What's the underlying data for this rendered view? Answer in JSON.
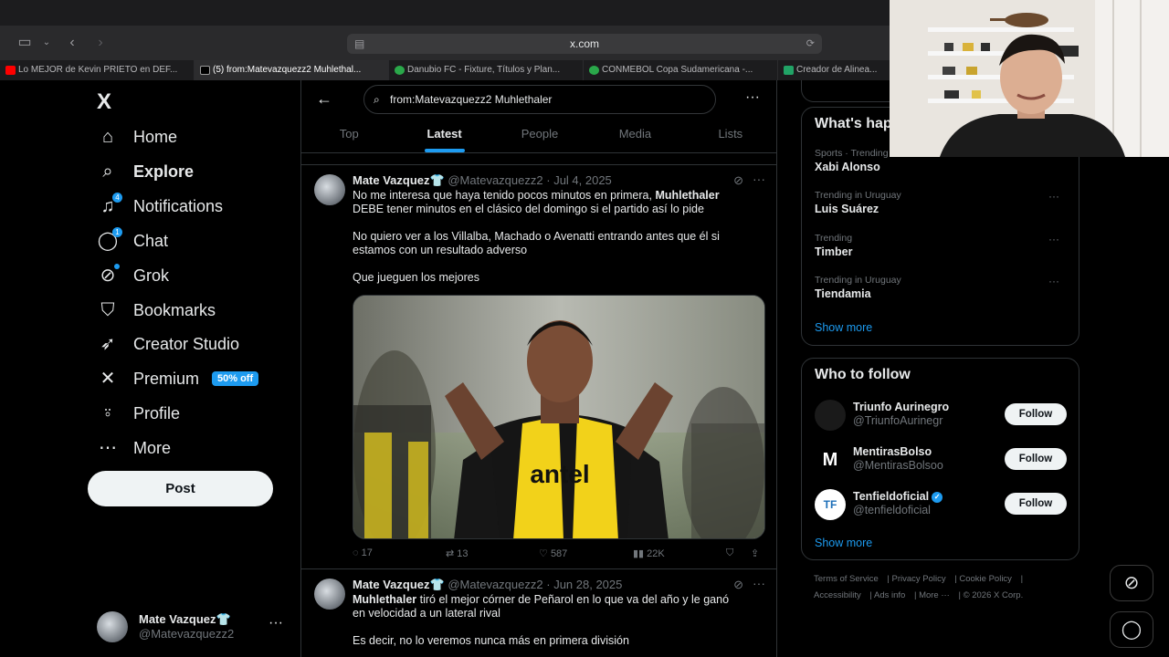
{
  "browser": {
    "url": "x.com",
    "tabs": [
      {
        "label": "Lo MEJOR de Kevin PRIETO en DEF...",
        "favicon_color": "#ff0000"
      },
      {
        "label": "(5) from:Matevazquezz2 Muhlethal...",
        "favicon_color": "#000000",
        "active": true
      },
      {
        "label": "Danubio FC - Fixture, Títulos y Plan...",
        "favicon_color": "#2aa84a"
      },
      {
        "label": "CONMEBOL Copa Sudamericana -...",
        "favicon_color": "#2aa84a"
      },
      {
        "label": "Creador de Alinea...",
        "favicon_color": "#21a366"
      }
    ]
  },
  "sidebar": {
    "logo": "X",
    "items": [
      {
        "label": "Home",
        "icon": "home-icon",
        "glyph": "⌂"
      },
      {
        "label": "Explore",
        "icon": "search-icon",
        "glyph": "⌕",
        "bold": true
      },
      {
        "label": "Notifications",
        "icon": "bell-icon",
        "glyph": "🔔︎",
        "badge": "4"
      },
      {
        "label": "Chat",
        "icon": "chat-icon",
        "glyph": "◯",
        "badge": "1"
      },
      {
        "label": "Grok",
        "icon": "grok-icon",
        "glyph": "⊘",
        "badge": "•"
      },
      {
        "label": "Bookmarks",
        "icon": "bookmark-icon",
        "glyph": "⛉"
      },
      {
        "label": "Creator Studio",
        "icon": "rocket-icon",
        "glyph": "➶"
      },
      {
        "label": "Premium",
        "icon": "x-premium-icon",
        "glyph": "✕",
        "pill": "50% off"
      },
      {
        "label": "Profile",
        "icon": "person-icon",
        "glyph": "⍤"
      },
      {
        "label": "More",
        "icon": "more-circle-icon",
        "glyph": "⋯"
      }
    ],
    "post_label": "Post",
    "account": {
      "name": "Mate Vazquez👕",
      "handle": "@Matevazquezz2"
    }
  },
  "search": {
    "query": "from:Matevazquezz2 Muhlethaler",
    "tabs": [
      "Top",
      "Latest",
      "People",
      "Media",
      "Lists"
    ],
    "active_tab": "Latest"
  },
  "tweets": [
    {
      "name": "Mate Vazquez👕",
      "handle": "@Matevazquezz2",
      "date": "Jul 4, 2025",
      "lines": [
        {
          "pre": "No me interesa que haya tenido pocos minutos en primera, ",
          "bold": "Muhlethaler",
          "post": ""
        },
        {
          "pre": "DEBE tener minutos en el clásico del domingo si el partido así lo pide",
          "bold": "",
          "post": ""
        },
        {
          "pre": "No quiero ver a los Villalba, Machado o Avenatti entrando antes que él si",
          "bold": "",
          "post": ""
        },
        {
          "pre": "estamos con un resultado adverso",
          "bold": "",
          "post": ""
        },
        {
          "pre": "Que jueguen los mejores",
          "bold": "",
          "post": ""
        }
      ],
      "replies": "17",
      "reposts": "13",
      "likes": "587",
      "views": "22K"
    },
    {
      "name": "Mate Vazquez👕",
      "handle": "@Matevazquezz2",
      "date": "Jun 28, 2025",
      "lines": [
        {
          "pre": "",
          "bold": "Muhlethaler",
          "post": " tiró el mejor córner de Peñarol en lo que va del año y le ganó"
        },
        {
          "pre": "en velocidad a un lateral rival",
          "bold": "",
          "post": ""
        },
        {
          "pre": "Es decir, no lo veremos nunca más en primera división",
          "bold": "",
          "post": ""
        }
      ]
    }
  ],
  "trends": {
    "title": "What's happening",
    "items": [
      {
        "category": "Sports · Trending",
        "name": "Xabi Alonso"
      },
      {
        "category": "Trending in Uruguay",
        "name": "Luis Suárez"
      },
      {
        "category": "Trending",
        "name": "Timber"
      },
      {
        "category": "Trending in Uruguay",
        "name": "Tiendamia"
      }
    ],
    "show_more": "Show more"
  },
  "who_to_follow": {
    "title": "Who to follow",
    "items": [
      {
        "name": "Triunfo Aurinegro",
        "handle": "@TriunfoAurinegr",
        "verified": false
      },
      {
        "name": "MentirasBolso",
        "handle": "@MentirasBolsoo",
        "verified": false,
        "avatar_letter": "M"
      },
      {
        "name": "Tenfieldoficial",
        "handle": "@tenfieldoficial",
        "verified": true,
        "avatar_letter": "TF"
      }
    ],
    "follow_label": "Follow",
    "show_more": "Show more"
  },
  "footer": {
    "links": [
      "Terms of Service",
      "Privacy Policy",
      "Cookie Policy",
      "Accessibility",
      "Ads info",
      "More ···",
      "© 2026 X Corp."
    ]
  },
  "colors": {
    "accent": "#1d9bf0",
    "background": "#000000",
    "text": "#e7e9ea",
    "muted": "#71767b",
    "border": "#2f3336"
  }
}
